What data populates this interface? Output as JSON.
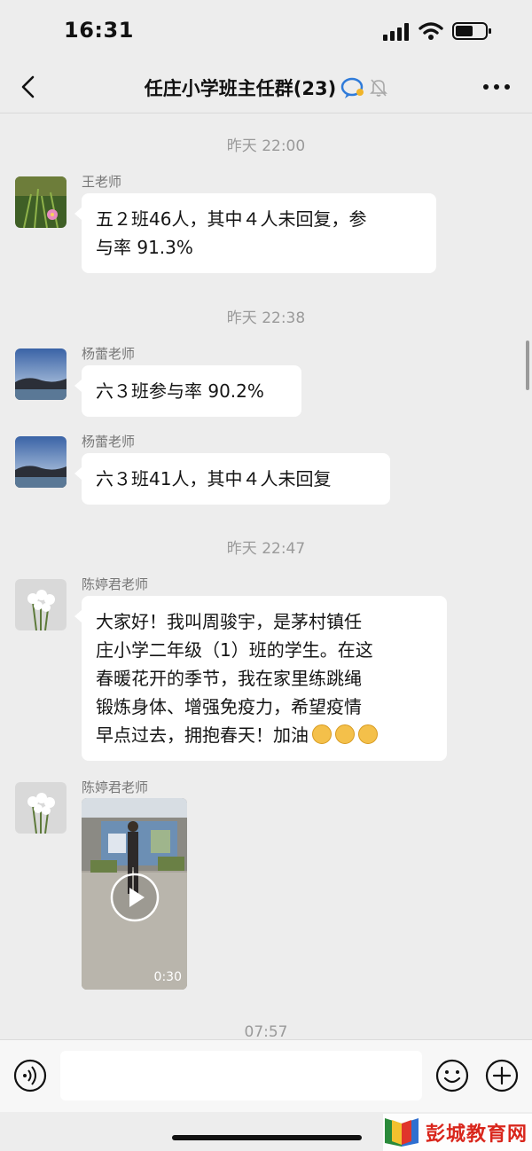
{
  "status_bar": {
    "time": "16:31"
  },
  "nav": {
    "title": "任庄小学班主任群(23)"
  },
  "messages": [
    {
      "timestamp": "昨天 22:00",
      "sender": "王老师",
      "text_lines": [
        "五２班46人，其中４人未回复，参",
        "与率 91.3%"
      ]
    },
    {
      "timestamp": "昨天 22:38",
      "sender": "杨蕾老师",
      "text_lines": [
        "六３班参与率 90.2%"
      ]
    },
    {
      "sender": "杨蕾老师",
      "text_lines": [
        "六３班41人，其中４人未回复"
      ]
    },
    {
      "timestamp": "昨天 22:47",
      "sender": "陈婷君老师",
      "text_lines": [
        "大家好！我叫周骏宇，是茅村镇任",
        "庄小学二年级（1）班的学生。在这",
        "春暖花开的季节，我在家里练跳绳",
        "锻炼身体、增强免疫力，希望疫情",
        "早点过去，拥抱春天！加油"
      ]
    },
    {
      "sender": "陈婷君老师",
      "video_duration": "0:30"
    },
    {
      "timestamp": "07:57"
    }
  ],
  "watermark": {
    "text": "彭城教育网"
  },
  "colors": {
    "background": "#ededed",
    "bubble": "#ffffff",
    "watermark_text": "#d9261c"
  }
}
